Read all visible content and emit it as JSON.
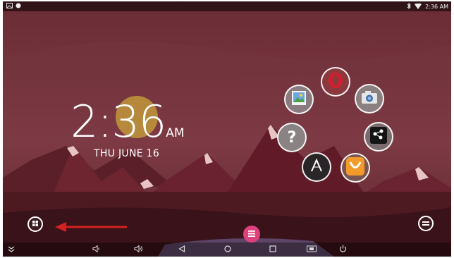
{
  "status_bar": {
    "time": "2:36 AM",
    "icons": [
      "gallery-notification-icon",
      "dot-notification-icon",
      "bluetooth-icon",
      "wifi-icon"
    ]
  },
  "clock": {
    "time": "2:36",
    "ampm": "AM",
    "date": "THU JUNE 16"
  },
  "app_ring": [
    {
      "name": "opera-browser",
      "icon": "opera-icon"
    },
    {
      "name": "camera",
      "icon": "camera-icon"
    },
    {
      "name": "autocad",
      "icon": "autocad-icon"
    },
    {
      "name": "aliexpress",
      "icon": "aliexpress-icon"
    },
    {
      "name": "glam-launcher",
      "icon": "letter-a-icon"
    },
    {
      "name": "help",
      "icon": "question-mark-icon"
    },
    {
      "name": "photos",
      "icon": "gallery-icon"
    }
  ],
  "app_text": {
    "help_symbol": "?"
  },
  "nav_bar": [
    "collapse-icon",
    "volume-down-icon",
    "volume-up-icon",
    "back-icon",
    "home-icon",
    "recents-icon",
    "screenshot-icon",
    "power-icon"
  ],
  "colors": {
    "accent": "#e0417c",
    "arrow": "#d42020",
    "background": "#3a1418"
  }
}
